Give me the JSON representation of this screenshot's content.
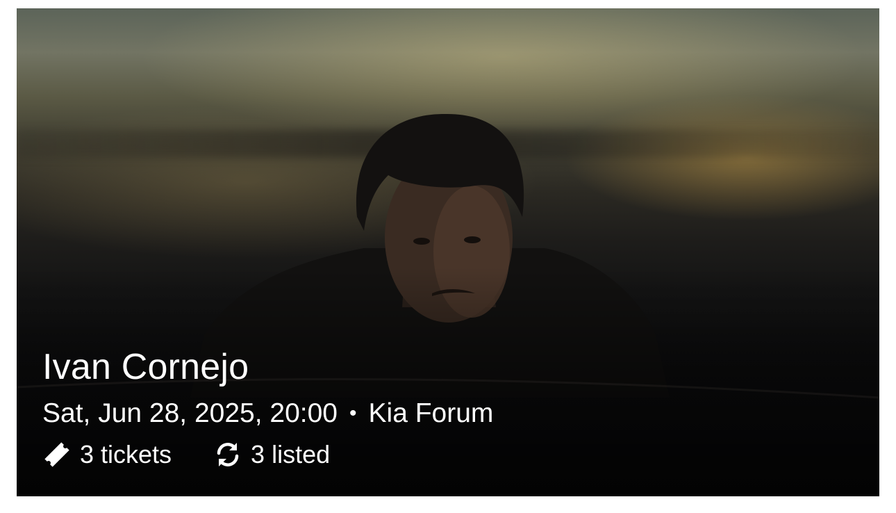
{
  "event": {
    "artist": "Ivan Cornejo",
    "date_time": "Sat, Jun 28, 2025, 20:00",
    "separator": "•",
    "venue": "Kia Forum",
    "tickets_label": "3 tickets",
    "listed_label": "3 listed",
    "tickets_icon": "ticket-icon",
    "listed_icon": "refresh-icon"
  }
}
